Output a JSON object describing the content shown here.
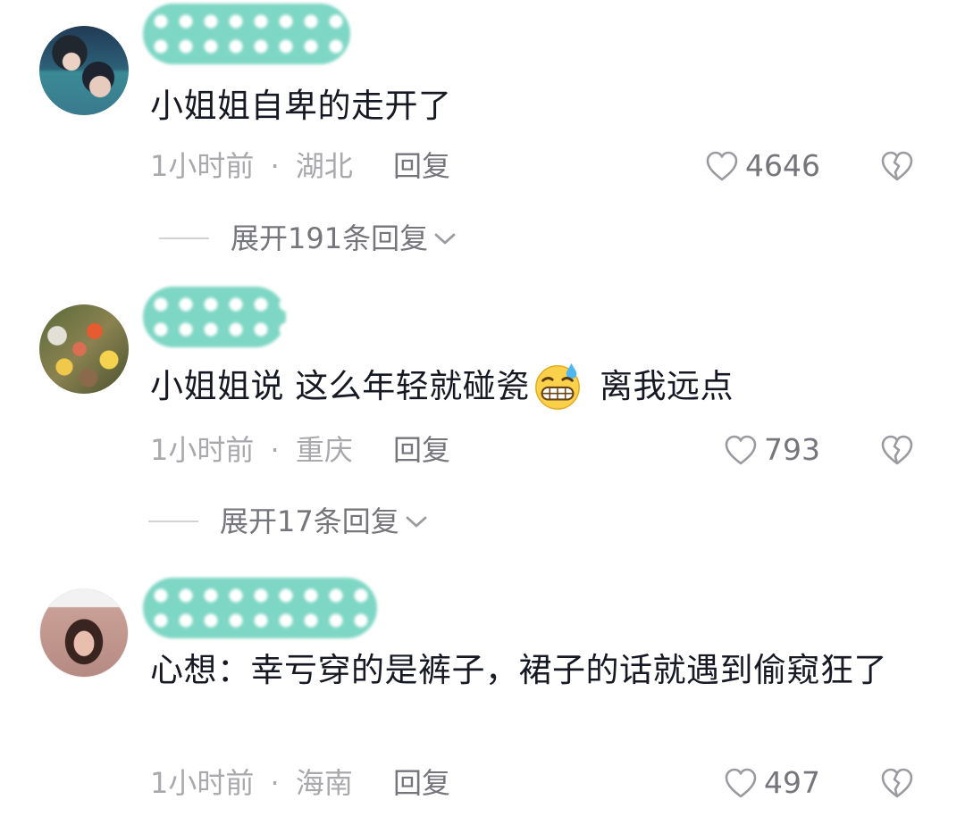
{
  "comments": [
    {
      "text_before": "小姐姐自卑的走开了",
      "text_after": "",
      "time": "1小时前",
      "separator": "·",
      "location": "湖北",
      "reply_label": "回复",
      "likes": "4646",
      "expand_label": "展开191条回复"
    },
    {
      "text_before": "小姐姐说 这么年轻就碰瓷",
      "emoji": "grimacing-sweat-emoji",
      "text_after": " 离我远点",
      "time": "1小时前",
      "separator": "·",
      "location": "重庆",
      "reply_label": "回复",
      "likes": "793",
      "expand_label": "展开17条回复"
    },
    {
      "text_before": "心想：幸亏穿的是裤子，裙子的话就遇到偷窥狂了",
      "text_after": "",
      "time": "1小时前",
      "separator": "·",
      "location": "海南",
      "reply_label": "回复",
      "likes": "497"
    }
  ],
  "icons": {
    "like": "heart-outline-icon",
    "dislike": "broken-heart-icon",
    "expand": "chevron-down-icon"
  },
  "colors": {
    "primary_text": "#161823",
    "secondary_text": "#a8a8ad",
    "action_text": "#75757c",
    "username_mask": "#7ed6c4"
  }
}
